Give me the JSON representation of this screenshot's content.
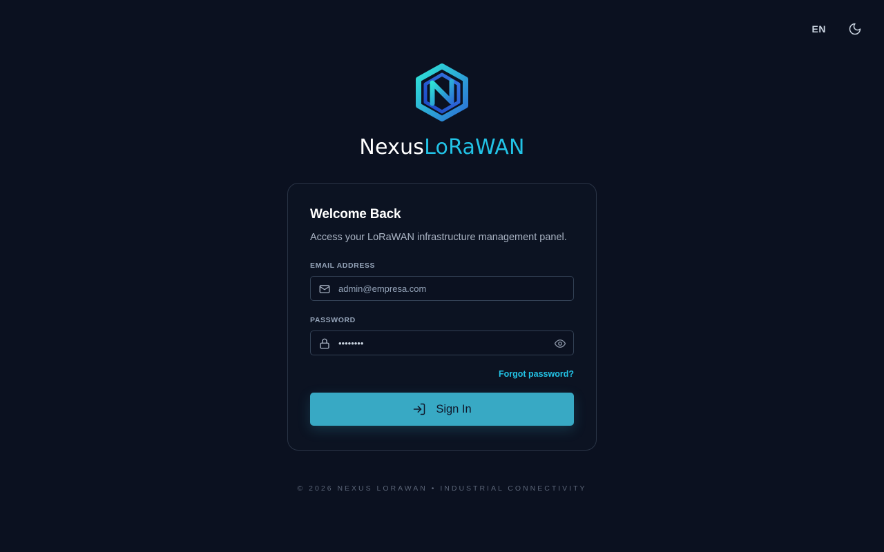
{
  "topbar": {
    "language": "EN",
    "theme_icon": "moon-icon"
  },
  "brand": {
    "name_part1": "Nexus",
    "name_part2": "LoRaWAN",
    "logo_icon": "nexus-logo-icon"
  },
  "login": {
    "title": "Welcome Back",
    "subtitle": "Access your LoRaWAN infrastructure management panel.",
    "email_label": "EMAIL ADDRESS",
    "email_placeholder": "admin@empresa.com",
    "email_icon": "mail-icon",
    "password_label": "PASSWORD",
    "password_value": "password",
    "password_icon": "lock-icon",
    "password_toggle_icon": "eye-icon",
    "forgot_link": "Forgot password?",
    "signin_label": "Sign In",
    "signin_icon": "log-in-icon"
  },
  "footer": {
    "text": "© 2026 NEXUS LORAWAN • INDUSTRIAL CONNECTIVITY"
  },
  "colors": {
    "background": "#0b1120",
    "accent": "#22c3e6",
    "button": "#38a9c4"
  }
}
